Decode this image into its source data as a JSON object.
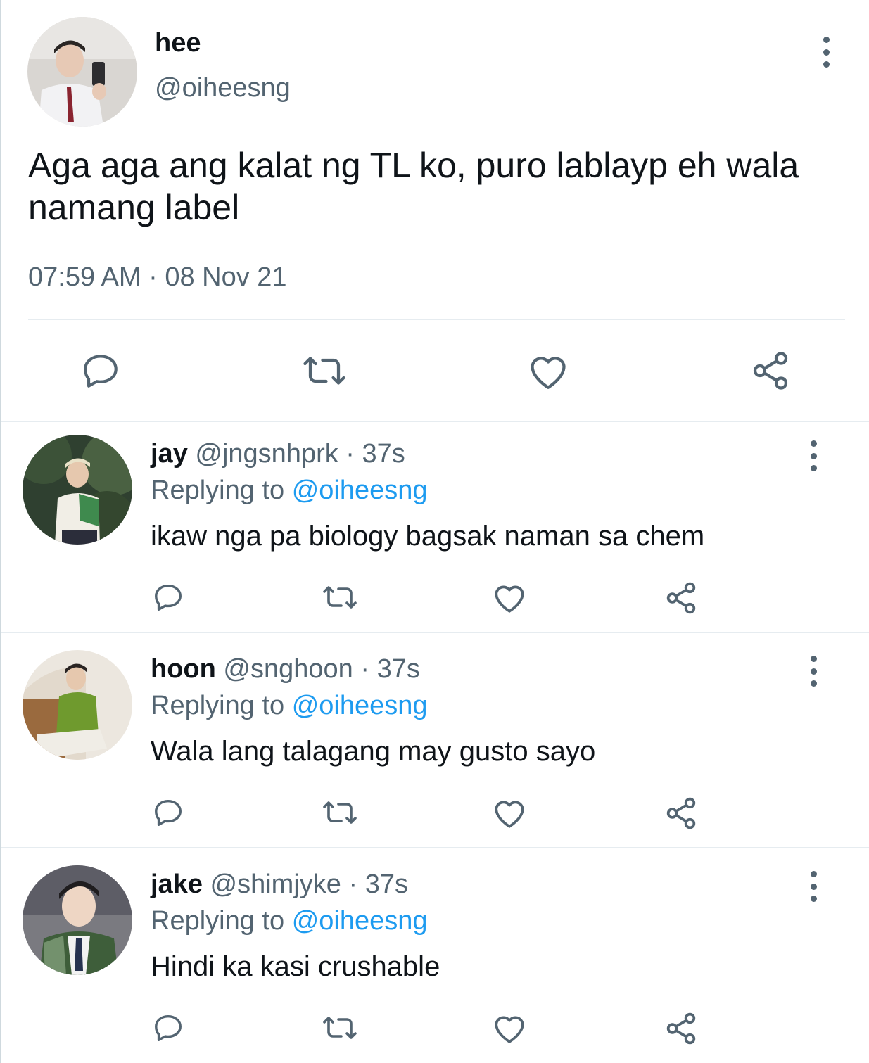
{
  "main_tweet": {
    "name": "hee",
    "handle": "@oiheesng",
    "text": "Aga aga ang kalat ng TL ko, puro lablayp eh wala namang label",
    "time": "07:59 AM",
    "sep": "·",
    "date": "08 Nov 21"
  },
  "colors": {
    "text": "#0f1419",
    "secondary": "#536471",
    "link": "#1d9bf0",
    "divider": "#e6ecf0"
  },
  "replies": [
    {
      "name": "jay",
      "handle": "@jngsnhprk",
      "age": "· 37s",
      "replying_label": "Replying to",
      "replying_to": "@oiheesng",
      "text": "ikaw nga pa biology bagsak naman sa chem"
    },
    {
      "name": "hoon",
      "handle": "@snghoon",
      "age": "· 37s",
      "replying_label": "Replying to",
      "replying_to": "@oiheesng",
      "text": "Wala lang talagang may gusto sayo"
    },
    {
      "name": "jake",
      "handle": "@shimjyke",
      "age": "· 37s",
      "replying_label": "Replying to",
      "replying_to": "@oiheesng",
      "text": "Hindi ka kasi crushable"
    }
  ],
  "icons": [
    "more-options-icon",
    "reply-icon",
    "retweet-icon",
    "like-icon",
    "share-icon"
  ]
}
